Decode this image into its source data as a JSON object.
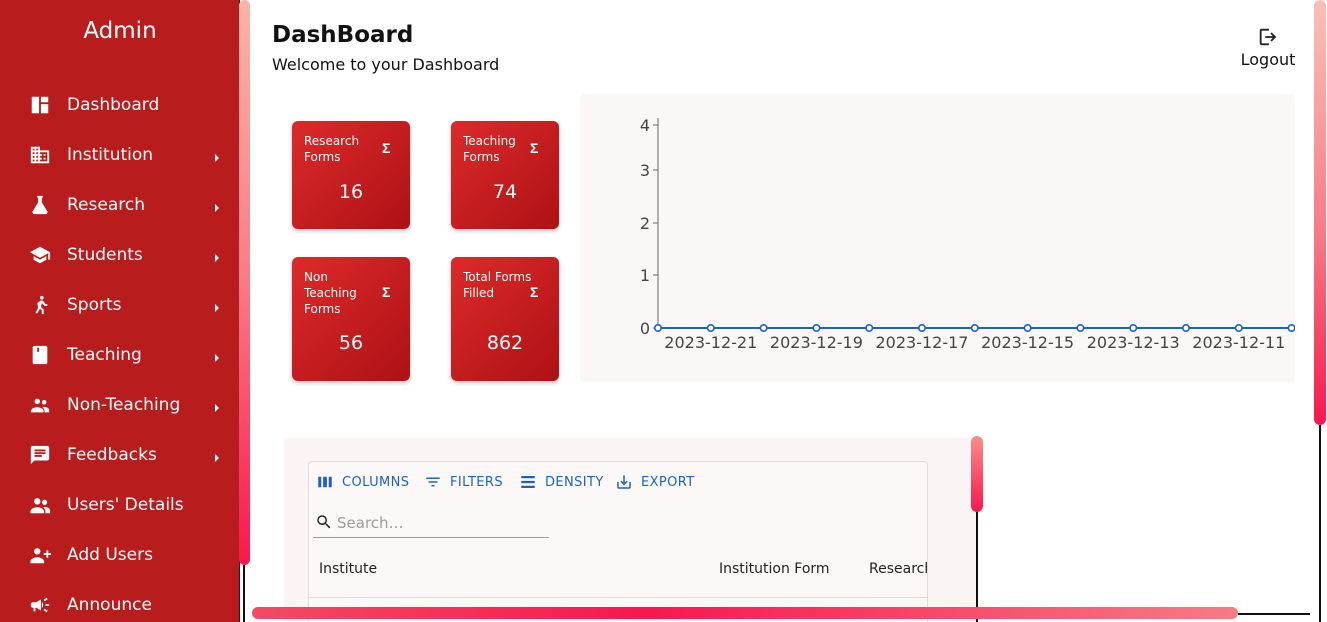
{
  "sidebar": {
    "title": "Admin",
    "items": [
      {
        "label": "Dashboard",
        "icon": "dashboard-icon",
        "has_submenu": false
      },
      {
        "label": "Institution",
        "icon": "building-icon",
        "has_submenu": true
      },
      {
        "label": "Research",
        "icon": "flask-icon",
        "has_submenu": true
      },
      {
        "label": "Students",
        "icon": "graduation-cap-icon",
        "has_submenu": true
      },
      {
        "label": "Sports",
        "icon": "sports-icon",
        "has_submenu": true
      },
      {
        "label": "Teaching",
        "icon": "book-icon",
        "has_submenu": true
      },
      {
        "label": "Non-Teaching",
        "icon": "people-icon",
        "has_submenu": true
      },
      {
        "label": "Feedbacks",
        "icon": "feedback-icon",
        "has_submenu": true
      },
      {
        "label": "Users' Details",
        "icon": "users-icon",
        "has_submenu": false
      },
      {
        "label": "Add Users",
        "icon": "add-user-icon",
        "has_submenu": false
      },
      {
        "label": "Announce",
        "icon": "megaphone-icon",
        "has_submenu": false
      }
    ]
  },
  "header": {
    "title": "DashBoard",
    "subtitle": "Welcome to your Dashboard",
    "logout_label": "Logout"
  },
  "cards": [
    {
      "label": "Research Forms",
      "value": "16",
      "icon": "sigma-icon"
    },
    {
      "label": "Teaching Forms",
      "value": "74",
      "icon": "sigma-icon"
    },
    {
      "label": "Non Teaching Forms",
      "value": "56",
      "icon": "sigma-icon"
    },
    {
      "label": "Total Forms Filled",
      "value": "862",
      "icon": "sigma-icon"
    }
  ],
  "chart_data": {
    "type": "line",
    "x": [
      "2023-12-22",
      "2023-12-21",
      "2023-12-20",
      "2023-12-19",
      "2023-12-18",
      "2023-12-17",
      "2023-12-16",
      "2023-12-15",
      "2023-12-14",
      "2023-12-13",
      "2023-12-12",
      "2023-12-11",
      "2023-12-10"
    ],
    "x_tick_labels": [
      "2023-12-21",
      "2023-12-19",
      "2023-12-17",
      "2023-12-15",
      "2023-12-13",
      "2023-12-11"
    ],
    "y_ticks": [
      "0",
      "1",
      "2",
      "3",
      "4"
    ],
    "series": [
      {
        "values": [
          0,
          0,
          0,
          0,
          0,
          0,
          0,
          0,
          0,
          0,
          0,
          0,
          0
        ],
        "color": "#1c62c4"
      }
    ],
    "ylim": [
      0,
      4
    ],
    "grid": false
  },
  "table": {
    "toolbar": [
      {
        "label": "COLUMNS",
        "icon": "columns-icon"
      },
      {
        "label": "FILTERS",
        "icon": "filter-icon"
      },
      {
        "label": "DENSITY",
        "icon": "density-icon"
      },
      {
        "label": "EXPORT",
        "icon": "export-icon"
      }
    ],
    "search_placeholder": "Search…",
    "columns": [
      "Institute",
      "Institution Form",
      "Research"
    ]
  },
  "colors": {
    "sidebar_bg": "#b91c1c",
    "card_bg": "#c81d1d",
    "accent_blue": "#1c62c4",
    "scrollbar": "#f8174e"
  }
}
